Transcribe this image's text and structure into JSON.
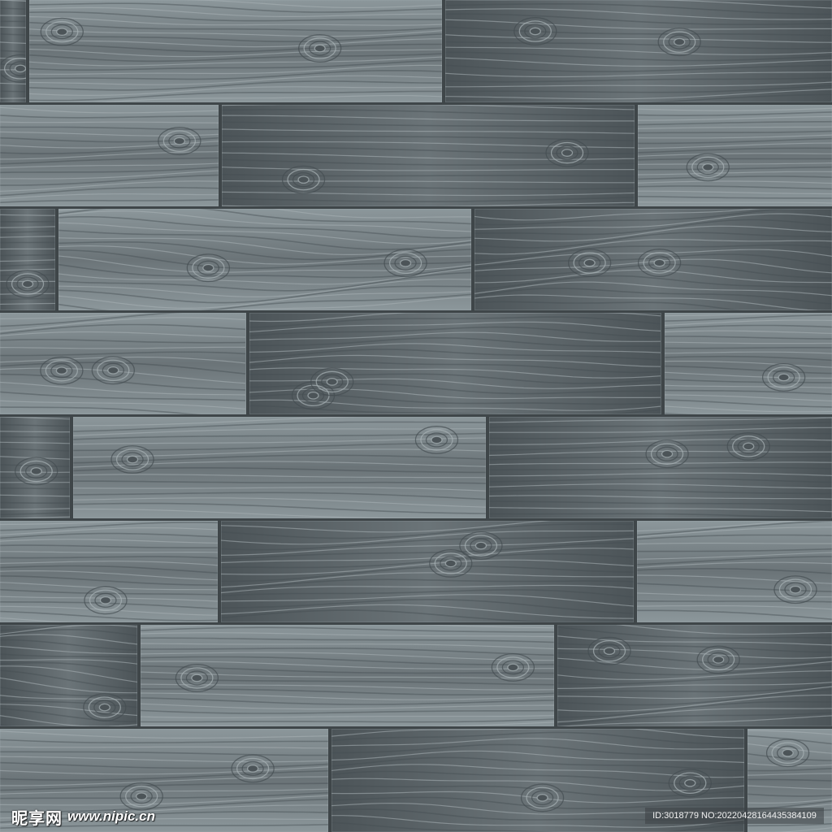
{
  "texture": {
    "subject": "gray wood plank floor texture",
    "colors": {
      "plank_base": "#6b7478",
      "plank_light": "#8c979b",
      "plank_dark": "#4c5458",
      "grain_light": "#a9b3b6",
      "grain_dark": "#454d51",
      "seam": "#3f4649"
    }
  },
  "watermark": {
    "brand": "昵享网",
    "site": "www.nipic.cn",
    "id_text": "ID:3018779 NO:20220428164435384109"
  }
}
